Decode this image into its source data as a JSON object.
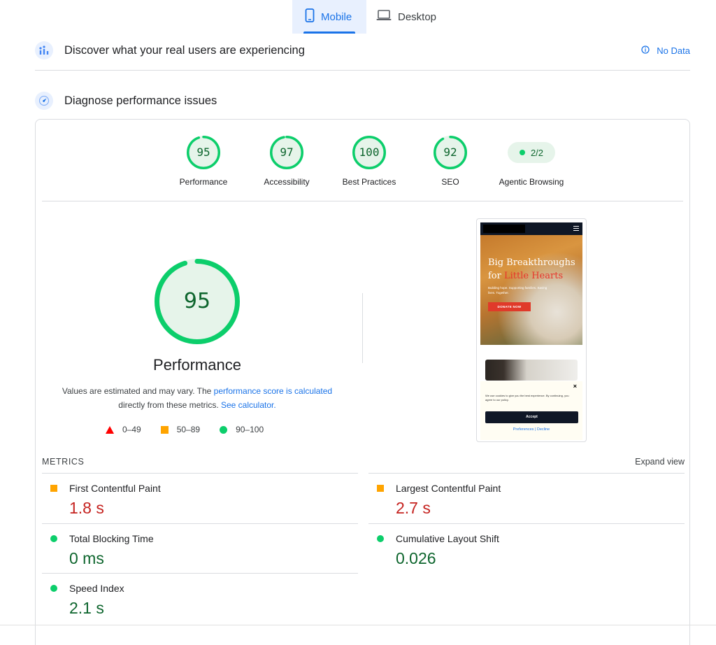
{
  "tabs": {
    "mobile": "Mobile",
    "desktop": "Desktop"
  },
  "field_data": {
    "title": "Discover what your real users are experiencing",
    "status": "No Data"
  },
  "lab": {
    "title": "Diagnose performance issues"
  },
  "categories": [
    {
      "label": "Performance",
      "score": "95",
      "fraction": 0.95
    },
    {
      "label": "Accessibility",
      "score": "97",
      "fraction": 0.97
    },
    {
      "label": "Best Practices",
      "score": "100",
      "fraction": 1.0
    },
    {
      "label": "SEO",
      "score": "92",
      "fraction": 0.92
    }
  ],
  "agentic": {
    "label": "Agentic Browsing",
    "value": "2/2"
  },
  "overview": {
    "score": "95",
    "score_fraction": 0.95,
    "title": "Performance",
    "desc_prefix": "Values are estimated and may vary. The ",
    "desc_link": "performance score is calculated",
    "desc_mid": "directly from these metrics. ",
    "calc_link": "See calculator."
  },
  "legend": {
    "bad": "0–49",
    "average": "50–89",
    "good": "90–100"
  },
  "preview": {
    "headline_white": "Big Breakthroughs for ",
    "headline_red": "Little Hearts",
    "subtext": "Building hope. Supporting families. Saving lives. Together.",
    "donate": "DONATE NOW",
    "cookie_close": "×",
    "cookie_text": "We use cookies to give you the best experience. By continuing, you agree to our policy.",
    "accept": "Accept",
    "links": "Preferences | Decline"
  },
  "metrics": {
    "header": "METRICS",
    "expand": "Expand view",
    "items": [
      {
        "name": "First Contentful Paint",
        "value": "1.8 s",
        "rating": "average"
      },
      {
        "name": "Largest Contentful Paint",
        "value": "2.7 s",
        "rating": "average"
      },
      {
        "name": "Total Blocking Time",
        "value": "0 ms",
        "rating": "good"
      },
      {
        "name": "Cumulative Layout Shift",
        "value": "0.026",
        "rating": "good"
      },
      {
        "name": "Speed Index",
        "value": "2.1 s",
        "rating": "good"
      }
    ]
  },
  "colors": {
    "accent": "#1a73e8",
    "good": "#0cce6b",
    "good_text": "#0d652d",
    "average": "#ffa400",
    "poor": "#ff0000",
    "value_red": "#c5221f"
  }
}
